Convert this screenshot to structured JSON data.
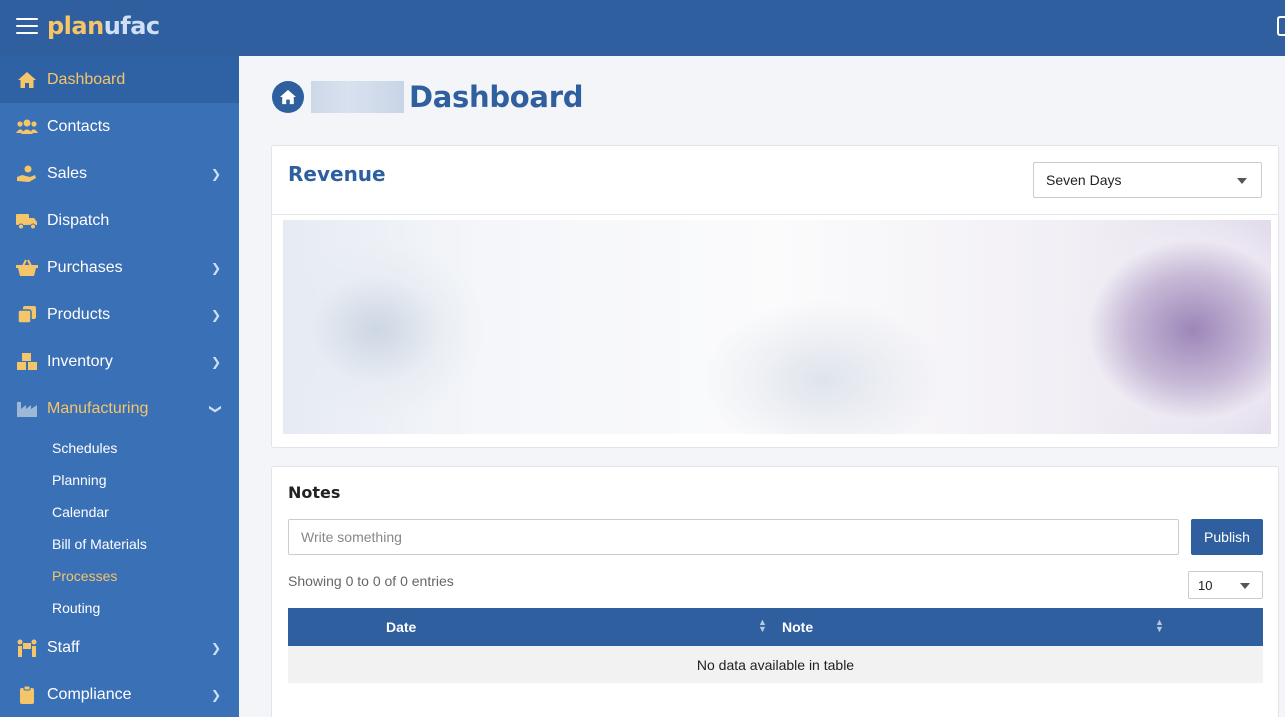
{
  "brand": {
    "logo_part1": "plan",
    "logo_part2": "ufac"
  },
  "sidebar": {
    "items": [
      {
        "label": "Dashboard",
        "icon": "home-icon"
      },
      {
        "label": "Contacts",
        "icon": "users-icon"
      },
      {
        "label": "Sales",
        "icon": "hand-coin-icon"
      },
      {
        "label": "Dispatch",
        "icon": "truck-icon"
      },
      {
        "label": "Purchases",
        "icon": "basket-icon"
      },
      {
        "label": "Products",
        "icon": "copy-icon"
      },
      {
        "label": "Inventory",
        "icon": "boxes-icon"
      },
      {
        "label": "Manufacturing",
        "icon": "industry-icon"
      },
      {
        "label": "Staff",
        "icon": "people-carry-icon"
      },
      {
        "label": "Compliance",
        "icon": "clipboard-icon"
      }
    ],
    "manufacturing_sub": [
      "Schedules",
      "Planning",
      "Calendar",
      "Bill of Materials",
      "Processes",
      "Routing"
    ]
  },
  "page": {
    "title": "Dashboard"
  },
  "revenue": {
    "title": "Revenue",
    "range_selected": "Seven Days"
  },
  "notes": {
    "title": "Notes",
    "input_placeholder": "Write something",
    "publish_label": "Publish",
    "entries_info": "Showing 0 to 0 of 0 entries",
    "page_length": "10",
    "columns": [
      "Date",
      "Note"
    ],
    "empty_message": "No data available in table"
  },
  "colors": {
    "primary": "#2f5f9f",
    "sidebar": "#3a70b6",
    "accent": "#f5c56a"
  }
}
